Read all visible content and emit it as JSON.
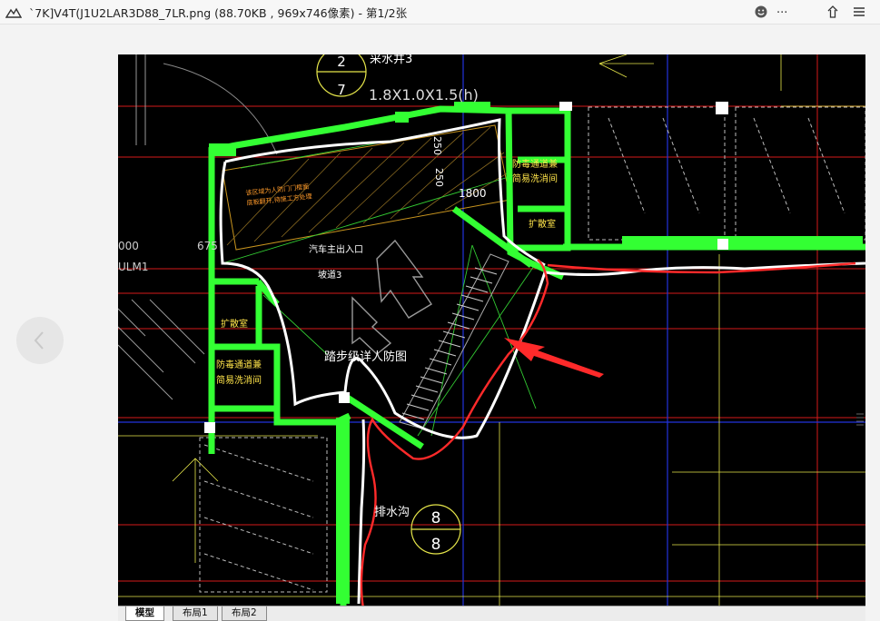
{
  "window": {
    "title": "`7K]V4T(J1U2LAR3D88_7LR.png (88.70KB , 969x746像素) - 第1/2张"
  },
  "toolbar": {
    "icons": [
      "image-viewer-logo-icon",
      "smiley-icon",
      "more-icon",
      "share-icon",
      "menu-icon"
    ],
    "more_label": "..."
  },
  "drawing": {
    "top_label": "采水井3",
    "top_bubble": {
      "top": "2",
      "bottom": "7"
    },
    "dimension_top": "1.8X1.0X1.5(h)",
    "dim_250": "250",
    "dim_250b": "250",
    "dim_1800": "1800",
    "dim_675": "675",
    "left_cut_label": "000",
    "left_tag": "ULM1",
    "room_expansion_top": "扩散室",
    "room_decon_top": "防毒通道兼\n简易洗消间",
    "room_expansion_left": "扩散室",
    "room_decon_left": "防毒通道兼\n简易洗消间",
    "entrance_label": "汽车主出入口",
    "ramp_label": "坡道3",
    "note_orange": "该区域为人防门门框面\n底板翻开,待施工方处理",
    "stair_label": "踏步级详人防图",
    "drain_label": "排水沟",
    "bottom_bubble": {
      "top": "8",
      "bottom": "8"
    }
  },
  "cad_tabs": [
    {
      "label": "模型",
      "active": true
    },
    {
      "label": "布局1",
      "active": false
    },
    {
      "label": "布局2",
      "active": false
    }
  ],
  "colors": {
    "wall_green": "#33ff33",
    "grid_red": "#e81e1e",
    "axis_blue": "#2233dd",
    "annotation_red": "#ff2a2a",
    "highlight_white": "#ffffff",
    "hatch_orange": "#c8941e"
  }
}
